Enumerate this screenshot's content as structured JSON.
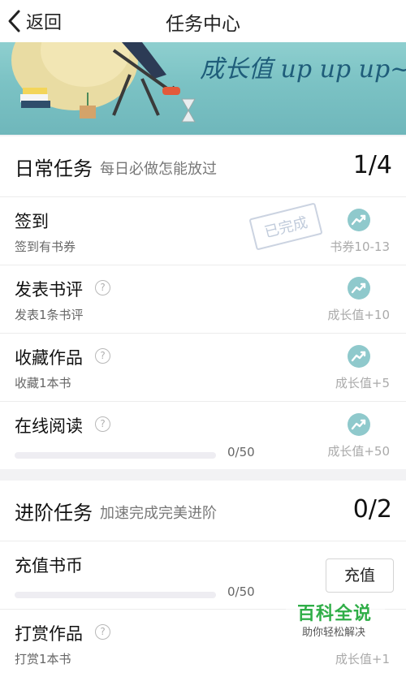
{
  "nav": {
    "back_label": "返回",
    "title": "任务中心"
  },
  "banner": {
    "slogan": "成长值 up up up~"
  },
  "daily": {
    "title": "日常任务",
    "subtitle": "每日必做怎能放过",
    "progress": "1/4",
    "items": [
      {
        "name": "签到",
        "desc": "签到有书券",
        "reward": "书券10-13",
        "status": "已完成"
      },
      {
        "name": "发表书评",
        "desc": "发表1条书评",
        "reward": "成长值+10"
      },
      {
        "name": "收藏作品",
        "desc": "收藏1本书",
        "reward": "成长值+5"
      },
      {
        "name": "在线阅读",
        "progress_text": "0/50",
        "progress_fraction": 0,
        "reward": "成长值+50"
      }
    ]
  },
  "advanced": {
    "title": "进阶任务",
    "subtitle": "加速完成完美进阶",
    "progress": "0/2",
    "items": [
      {
        "name": "充值书币",
        "progress_text": "0/50",
        "progress_fraction": 0,
        "button": "充值"
      },
      {
        "name": "打赏作品",
        "desc": "打赏1本书",
        "reward": "成长值+1"
      }
    ]
  },
  "watermark": {
    "main": "百科全说",
    "sub": "助你轻松解决"
  },
  "colors": {
    "accent_teal": "#8fc9cc",
    "banner_bg": "#7bc2c4",
    "watermark_green": "#2fae47"
  },
  "icons": {
    "task_status": "trend-up-icon",
    "help": "question-circle-icon",
    "back": "chevron-left-icon"
  }
}
